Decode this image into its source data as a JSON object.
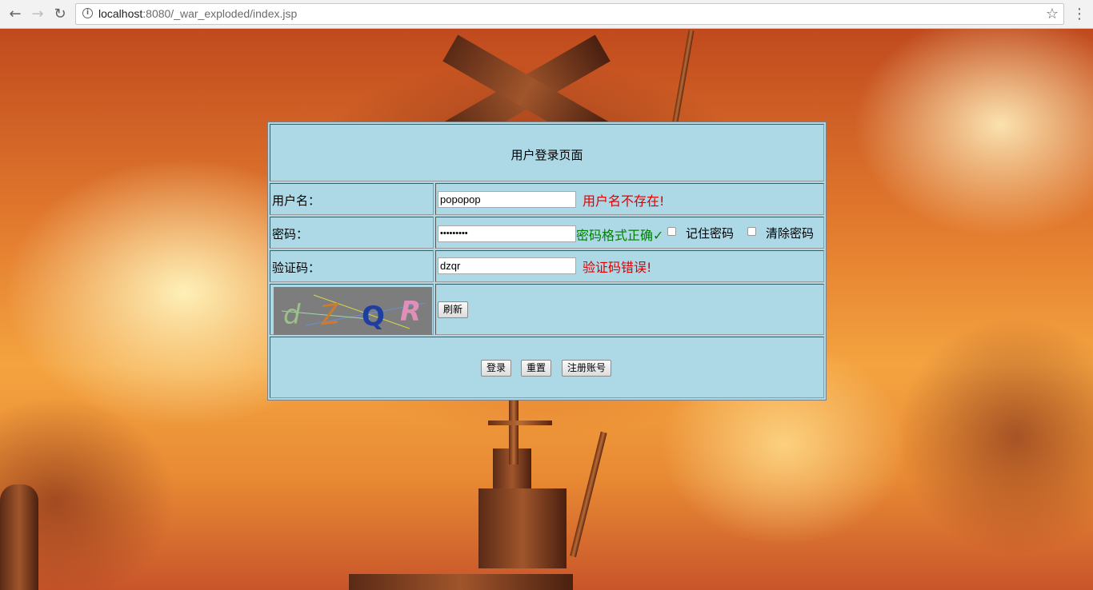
{
  "browser": {
    "url_host": "localhost",
    "url_rest": ":8080/_war_exploded/index.jsp",
    "info_glyph": "i",
    "back_glyph": "←",
    "forward_glyph": "→",
    "reload_glyph": "↻",
    "star_glyph": "☆",
    "menu_glyph": "⋮"
  },
  "form": {
    "title": "用户登录页面",
    "username_label": "用户名：",
    "username_value": "popopop",
    "username_error": "用户名不存在!",
    "password_label": "密码：",
    "password_value": "popopopop",
    "password_status": "密码格式正确✓",
    "remember_label": "记住密码",
    "clear_label": "清除密码",
    "captcha_label": "验证码：",
    "captcha_value": "dzqr",
    "captcha_error": "验证码错误!",
    "captcha_chars": [
      "d",
      "Z",
      "Q",
      "R"
    ],
    "refresh_button": "刷新",
    "login_button": "登录",
    "reset_button": "重置",
    "register_button": "注册账号"
  },
  "colors": {
    "form_bg": "#add8e6",
    "error": "#e00000",
    "success": "#008000"
  }
}
